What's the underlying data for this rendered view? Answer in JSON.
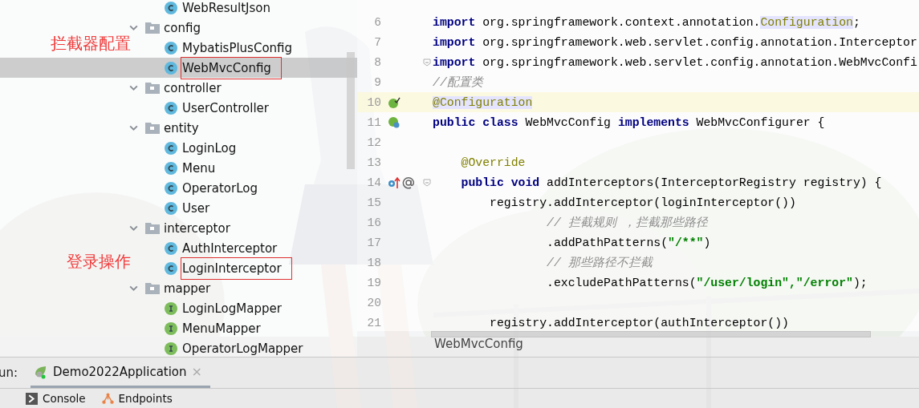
{
  "tree": [
    {
      "children": [
        {
          "label": "WebResultJson",
          "kind": "class",
          "selected": false,
          "marked": false
        }
      ]
    },
    {
      "label": "config",
      "kind": "folder",
      "expanded": true,
      "children": [
        {
          "label": "MybatisPlusConfig",
          "kind": "class",
          "selected": false,
          "marked": false
        },
        {
          "label": "WebMvcConfig",
          "kind": "class",
          "selected": true,
          "marked": true,
          "note": "拦截器配置"
        }
      ]
    },
    {
      "label": "controller",
      "kind": "folder",
      "expanded": true,
      "children": [
        {
          "label": "UserController",
          "kind": "class",
          "selected": false,
          "marked": false
        }
      ]
    },
    {
      "label": "entity",
      "kind": "folder",
      "expanded": true,
      "children": [
        {
          "label": "LoginLog",
          "kind": "class",
          "selected": false,
          "marked": false
        },
        {
          "label": "Menu",
          "kind": "class",
          "selected": false,
          "marked": false
        },
        {
          "label": "OperatorLog",
          "kind": "class",
          "selected": false,
          "marked": false
        },
        {
          "label": "User",
          "kind": "class",
          "selected": false,
          "marked": false
        }
      ]
    },
    {
      "label": "interceptor",
      "kind": "folder",
      "expanded": true,
      "children": [
        {
          "label": "AuthInterceptor",
          "kind": "class",
          "selected": false,
          "marked": false
        },
        {
          "label": "LoginInterceptor",
          "kind": "class",
          "selected": false,
          "marked": true,
          "note": "登录操作"
        }
      ]
    },
    {
      "label": "mapper",
      "kind": "folder",
      "expanded": true,
      "children": [
        {
          "label": "LoginLogMapper",
          "kind": "interface",
          "selected": false,
          "marked": false
        },
        {
          "label": "MenuMapper",
          "kind": "interface",
          "selected": false,
          "marked": false
        },
        {
          "label": "OperatorLogMapper",
          "kind": "interface",
          "selected": false,
          "marked": false
        }
      ]
    }
  ],
  "editor": {
    "lines": [
      {
        "number": "6",
        "current": false,
        "fold": false,
        "tokens": [
          {
            "kind": "keyword",
            "text": "import"
          },
          {
            "kind": "plain",
            "text": " org.springframework.context.annotation."
          },
          {
            "kind": "usage",
            "text": "Configuration"
          },
          {
            "kind": "plain",
            "text": ";"
          }
        ]
      },
      {
        "number": "7",
        "current": false,
        "fold": false,
        "tokens": [
          {
            "kind": "keyword",
            "text": "import"
          },
          {
            "kind": "plain",
            "text": " org.springframework.web.servlet.config.annotation.Interceptor"
          }
        ]
      },
      {
        "number": "8",
        "current": false,
        "fold": true,
        "tokens": [
          {
            "kind": "keyword",
            "text": "import"
          },
          {
            "kind": "plain",
            "text": " org.springframework.web.servlet.config.annotation.WebMvcConfi"
          }
        ]
      },
      {
        "number": "9",
        "current": false,
        "fold": false,
        "tokens": [
          {
            "kind": "comment",
            "text": "//配置类"
          }
        ]
      },
      {
        "number": "10",
        "current": true,
        "fold": false,
        "gutter": [
          {
            "kind": "bean"
          }
        ],
        "tokens": [
          {
            "kind": "usage",
            "text": "@Configuration"
          }
        ]
      },
      {
        "number": "11",
        "current": false,
        "fold": false,
        "gutter": [
          {
            "kind": "bean-impl"
          }
        ],
        "tokens": [
          {
            "kind": "keyword",
            "text": "public class"
          },
          {
            "kind": "plain",
            "text": " WebMvcConfig "
          },
          {
            "kind": "keyword",
            "text": "implements"
          },
          {
            "kind": "plain",
            "text": " WebMvcConfigurer {"
          }
        ]
      },
      {
        "number": "12",
        "current": false,
        "fold": false
      },
      {
        "number": "13",
        "current": false,
        "fold": false,
        "tokens": [
          {
            "kind": "annotation",
            "text": "    @Override"
          }
        ]
      },
      {
        "number": "14",
        "current": false,
        "fold": true,
        "gutter": [
          {
            "kind": "override"
          },
          {
            "kind": "at"
          }
        ],
        "tokens": [
          {
            "kind": "keyword",
            "text": "    public void"
          },
          {
            "kind": "plain",
            "text": " addInterceptors(InterceptorRegistry registry) {"
          }
        ]
      },
      {
        "number": "15",
        "current": false,
        "fold": false,
        "tokens": [
          {
            "kind": "plain",
            "text": "        registry.addInterceptor(loginInterceptor())"
          }
        ]
      },
      {
        "number": "16",
        "current": false,
        "fold": false,
        "tokens": [
          {
            "kind": "comment",
            "text": "                // 拦截规则 ，拦截那些路径"
          }
        ]
      },
      {
        "number": "17",
        "current": false,
        "fold": false,
        "tokens": [
          {
            "kind": "plain",
            "text": "                .addPathPatterns("
          },
          {
            "kind": "string",
            "text": "\"/**\""
          },
          {
            "kind": "plain",
            "text": ")"
          }
        ]
      },
      {
        "number": "18",
        "current": false,
        "fold": false,
        "tokens": [
          {
            "kind": "comment",
            "text": "                // 那些路径不拦截"
          }
        ]
      },
      {
        "number": "19",
        "current": false,
        "fold": false,
        "tokens": [
          {
            "kind": "plain",
            "text": "                .excludePathPatterns("
          },
          {
            "kind": "string",
            "text": "\"/user/login\",\"/error\""
          },
          {
            "kind": "plain",
            "text": ");"
          }
        ]
      },
      {
        "number": "20",
        "current": false,
        "fold": false
      },
      {
        "number": "21",
        "current": false,
        "fold": false,
        "tokens": [
          {
            "kind": "plain",
            "text": "        registry.addInterceptor(authInterceptor())"
          }
        ]
      }
    ],
    "breadcrumb": "WebMvcConfig"
  },
  "run_bar": {
    "label": "un:",
    "tabs": [
      {
        "label": "Demo2022Application",
        "selected": true,
        "close": "×"
      }
    ]
  },
  "bottom_tabs": [
    {
      "label": "Console",
      "kind": "console"
    },
    {
      "label": "Endpoints",
      "kind": "endpoints"
    }
  ]
}
